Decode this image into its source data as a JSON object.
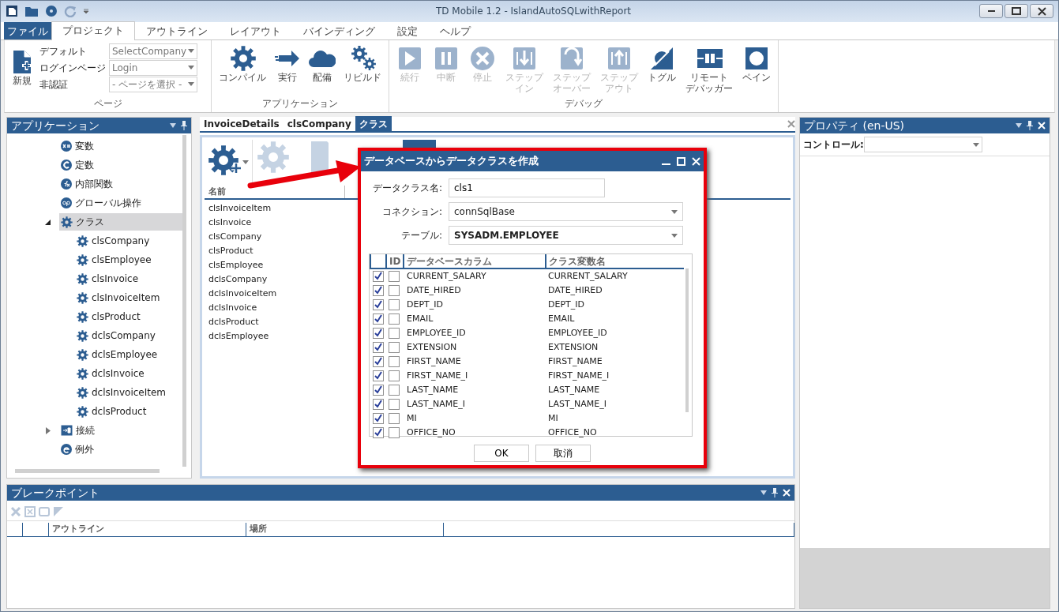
{
  "window": {
    "title": "TD Mobile 1.2 - IslandAutoSQLwithReport"
  },
  "ribbon": {
    "tabs": [
      {
        "label": "ファイル",
        "kind": "file",
        "selected": false
      },
      {
        "label": "プロジェクト",
        "kind": "tab",
        "selected": true
      },
      {
        "label": "アウトライン",
        "kind": "tab",
        "selected": false
      },
      {
        "label": "レイアウト",
        "kind": "tab",
        "selected": false
      },
      {
        "label": "バインディング",
        "kind": "tab",
        "selected": false
      },
      {
        "label": "設定",
        "kind": "tab",
        "selected": false
      },
      {
        "label": "ヘルプ",
        "kind": "tab",
        "selected": false
      }
    ],
    "page_group": {
      "label": "ページ",
      "new_label": "新規",
      "fields": [
        {
          "label": "デフォルト",
          "value": "SelectCompany"
        },
        {
          "label": "ログインページ",
          "value": "Login"
        },
        {
          "label": "非認証",
          "value": "- ページを選択 -"
        }
      ]
    },
    "groups": [
      {
        "label": "アプリケーション",
        "buttons": [
          {
            "label": "コンパイル",
            "kind": "compile",
            "disabled": false
          },
          {
            "label": "実行",
            "kind": "run",
            "disabled": false
          },
          {
            "label": "配備",
            "kind": "deploy",
            "disabled": false
          },
          {
            "label": "リビルド",
            "kind": "rebuild",
            "disabled": false
          }
        ]
      },
      {
        "label": "デバッグ",
        "buttons": [
          {
            "label": "続行",
            "kind": "continue",
            "disabled": true
          },
          {
            "label": "中断",
            "kind": "pause",
            "disabled": true
          },
          {
            "label": "停止",
            "kind": "stop",
            "disabled": true
          },
          {
            "label": "ステップ",
            "label_2": "イン",
            "kind": "step_in",
            "disabled": true
          },
          {
            "label": "ステップ",
            "label_2": "オーバー",
            "kind": "step_over",
            "disabled": true
          },
          {
            "label": "ステップ",
            "label_2": "アウト",
            "kind": "step_out",
            "disabled": true
          },
          {
            "label": "トグル",
            "kind": "toggle",
            "disabled": false
          },
          {
            "label": "リモート",
            "label_2": "デバッガー",
            "kind": "remote",
            "disabled": false
          },
          {
            "label": "ペイン",
            "kind": "pane",
            "disabled": false
          }
        ]
      }
    ]
  },
  "application_panel": {
    "title": "アプリケーション",
    "tree": [
      {
        "label": "変数",
        "kind": "variable",
        "selected": false
      },
      {
        "label": "定数",
        "kind": "constant",
        "selected": false
      },
      {
        "label": "内部関数",
        "kind": "function",
        "selected": false
      },
      {
        "label": "グローバル操作",
        "kind": "operation",
        "selected": false
      },
      {
        "label": "クラス",
        "kind": "class",
        "selected": true,
        "expanded": true,
        "children": [
          {
            "label": "clsCompany",
            "kind": "class",
            "selected": false
          },
          {
            "label": "clsEmployee",
            "kind": "class",
            "selected": false
          },
          {
            "label": "clsInvoice",
            "kind": "class",
            "selected": false
          },
          {
            "label": "clsInvoiceItem",
            "kind": "class",
            "selected": false
          },
          {
            "label": "clsProduct",
            "kind": "class",
            "selected": false
          },
          {
            "label": "dclsCompany",
            "kind": "class",
            "selected": false
          },
          {
            "label": "dclsEmployee",
            "kind": "class",
            "selected": false
          },
          {
            "label": "dclsInvoice",
            "kind": "class",
            "selected": false
          },
          {
            "label": "dclsInvoiceItem",
            "kind": "class",
            "selected": false
          },
          {
            "label": "dclsProduct",
            "kind": "class",
            "selected": false
          }
        ]
      },
      {
        "label": "接続",
        "kind": "connection",
        "selected": false,
        "expanded": false
      },
      {
        "label": "例外",
        "kind": "exception",
        "selected": false
      }
    ]
  },
  "document": {
    "tabs": [
      {
        "label": "InvoiceDetails",
        "selected": false
      },
      {
        "label": "clsCompany",
        "selected": false
      },
      {
        "label": "クラス",
        "selected": true
      }
    ],
    "columns": [
      "名前"
    ],
    "items": [
      "clsInvoiceItem",
      "clsInvoice",
      "clsCompany",
      "clsProduct",
      "clsEmployee",
      "dclsCompany",
      "dclsInvoiceItem",
      "dclsInvoice",
      "dclsProduct",
      "dclsEmployee"
    ]
  },
  "dialog": {
    "title": "データベースからデータクラスを作成",
    "fields": [
      {
        "label": "データクラス名:",
        "value": "cls1",
        "kind": "text"
      },
      {
        "label": "コネクション:",
        "value": "connSqlBase",
        "kind": "select"
      },
      {
        "label": "テーブル:",
        "value": "SYSADM.EMPLOYEE",
        "kind": "select"
      }
    ],
    "grid": {
      "columns": [
        "ID",
        "データベースカラム",
        "クラス変数名"
      ],
      "rows": [
        {
          "include": true,
          "id": false,
          "column": "CURRENT_SALARY",
          "variable": "CURRENT_SALARY"
        },
        {
          "include": true,
          "id": false,
          "column": "DATE_HIRED",
          "variable": "DATE_HIRED"
        },
        {
          "include": true,
          "id": false,
          "column": "DEPT_ID",
          "variable": "DEPT_ID"
        },
        {
          "include": true,
          "id": false,
          "column": "EMAIL",
          "variable": "EMAIL"
        },
        {
          "include": true,
          "id": false,
          "column": "EMPLOYEE_ID",
          "variable": "EMPLOYEE_ID"
        },
        {
          "include": true,
          "id": false,
          "column": "EXTENSION",
          "variable": "EXTENSION"
        },
        {
          "include": true,
          "id": false,
          "column": "FIRST_NAME",
          "variable": "FIRST_NAME"
        },
        {
          "include": true,
          "id": false,
          "column": "FIRST_NAME_I",
          "variable": "FIRST_NAME_I"
        },
        {
          "include": true,
          "id": false,
          "column": "LAST_NAME",
          "variable": "LAST_NAME"
        },
        {
          "include": true,
          "id": false,
          "column": "LAST_NAME_I",
          "variable": "LAST_NAME_I"
        },
        {
          "include": true,
          "id": false,
          "column": "MI",
          "variable": "MI"
        },
        {
          "include": true,
          "id": false,
          "column": "OFFICE_NO",
          "variable": "OFFICE_NO"
        }
      ]
    },
    "buttons": [
      "OK",
      "取消"
    ]
  },
  "properties_panel": {
    "title": "プロパティ (en-US)",
    "control_label": "コントロール:"
  },
  "breakpoints_panel": {
    "title": "ブレークポイント",
    "columns": [
      "アウトライン",
      "場所"
    ]
  }
}
